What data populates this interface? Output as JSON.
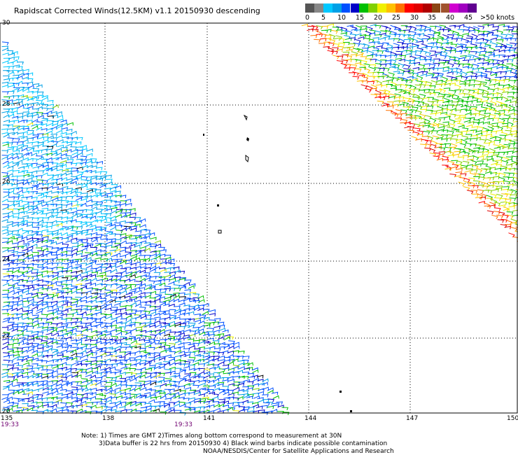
{
  "title": "Rapidscat Corrected Winds(12.5KM) v1.1 20150930 descending",
  "colorbar": {
    "unit_label": ">50 knots",
    "tick_labels": [
      "0",
      "5",
      "10",
      "15",
      "20",
      "25",
      "30",
      "35",
      "40",
      "45"
    ],
    "colors": [
      "#555555",
      "#888888",
      "#00c8ff",
      "#00a0e6",
      "#0050ff",
      "#0000c8",
      "#00c000",
      "#80d000",
      "#f0f000",
      "#ffc000",
      "#ff7000",
      "#ff0000",
      "#e00000",
      "#b00000",
      "#8b4513",
      "#a0522d",
      "#d000d0",
      "#a000c0",
      "#600090"
    ]
  },
  "map": {
    "lat_labels": [
      "30",
      "28",
      "26",
      "24",
      "22",
      "20"
    ],
    "lon_labels": [
      "135",
      "138",
      "141",
      "144",
      "147",
      "150"
    ],
    "pass_times": [
      "19:33",
      "19:33"
    ]
  },
  "notes": {
    "line1": "Note: 1) Times are GMT 2)Times along bottom correspond to measurement at 30N",
    "line2": "3)Data buffer is 22 hrs from 20150930 4) Black wind barbs indicate possible contamination",
    "line3": "NOAA/NESDIS/Center for Satellite Applications and Research"
  }
}
